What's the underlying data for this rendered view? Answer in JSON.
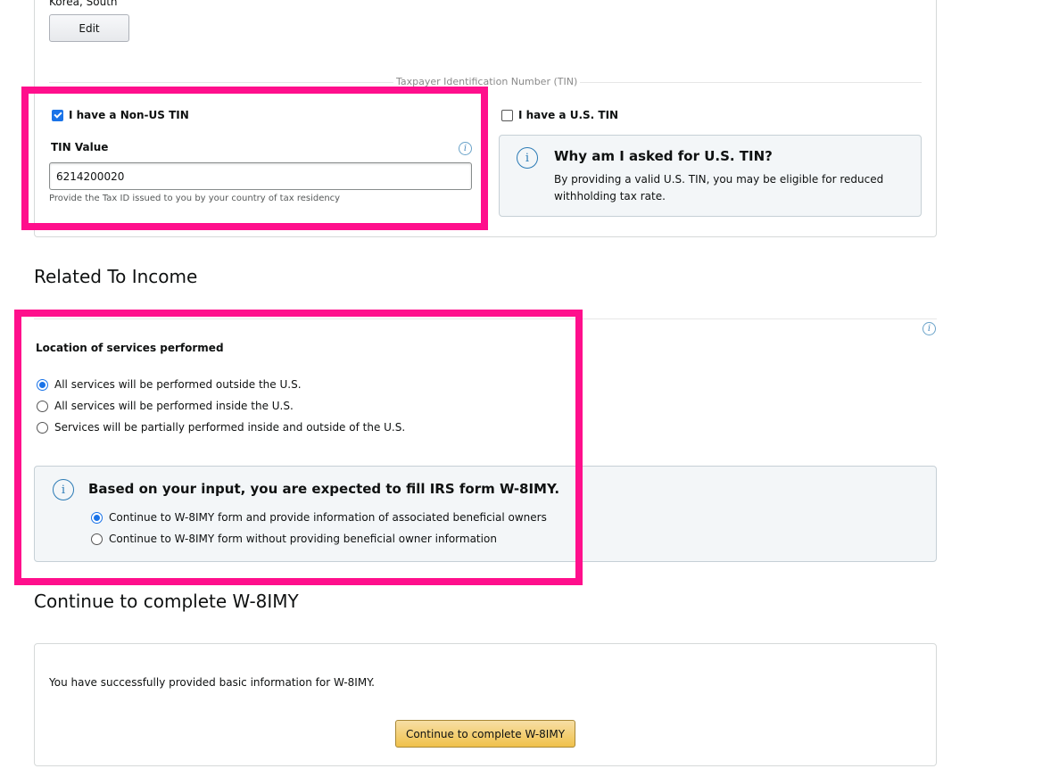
{
  "tin_section": {
    "country_text": "Korea, South",
    "edit_label": "Edit",
    "divider_label": "Taxpayer Identification Number (TIN)",
    "non_us_tin": {
      "label": "I have a Non-US TIN",
      "checked": true
    },
    "us_tin": {
      "label": "I have a U.S. TIN",
      "checked": false
    },
    "tin_value_label": "TIN Value",
    "tin_value": "6214200020",
    "tin_hint": "Provide the Tax ID issued to you by your country of tax residency",
    "why_box": {
      "title": "Why am I asked for U.S. TIN?",
      "text": "By providing a valid U.S. TIN, you may be eligible for reduced withholding tax rate."
    },
    "info_glyph": "i"
  },
  "income_section": {
    "title": "Related To Income",
    "location_label": "Location of services performed",
    "location_options": [
      {
        "label": "All services will be performed outside the U.S.",
        "checked": true
      },
      {
        "label": "All services will be performed inside the U.S.",
        "checked": false
      },
      {
        "label": "Services will be partially performed inside and outside of the U.S.",
        "checked": false
      }
    ],
    "form_notice": {
      "title": "Based on your input, you are expected to fill IRS form W-8IMY.",
      "options": [
        {
          "label": "Continue to W-8IMY form and provide information of associated beneficial owners",
          "checked": true
        },
        {
          "label": "Continue to W-8IMY form without providing beneficial owner information",
          "checked": false
        }
      ]
    }
  },
  "continue_section": {
    "title": "Continue to complete W-8IMY",
    "success_text": "You have successfully provided basic information for W-8IMY.",
    "button_label": "Continue to complete W-8IMY"
  },
  "colors": {
    "highlight": "#ff0f8c",
    "primary_button": "#f0c14b",
    "info_accent": "#2a7ab5",
    "radio_accent": "#1a73e8"
  }
}
